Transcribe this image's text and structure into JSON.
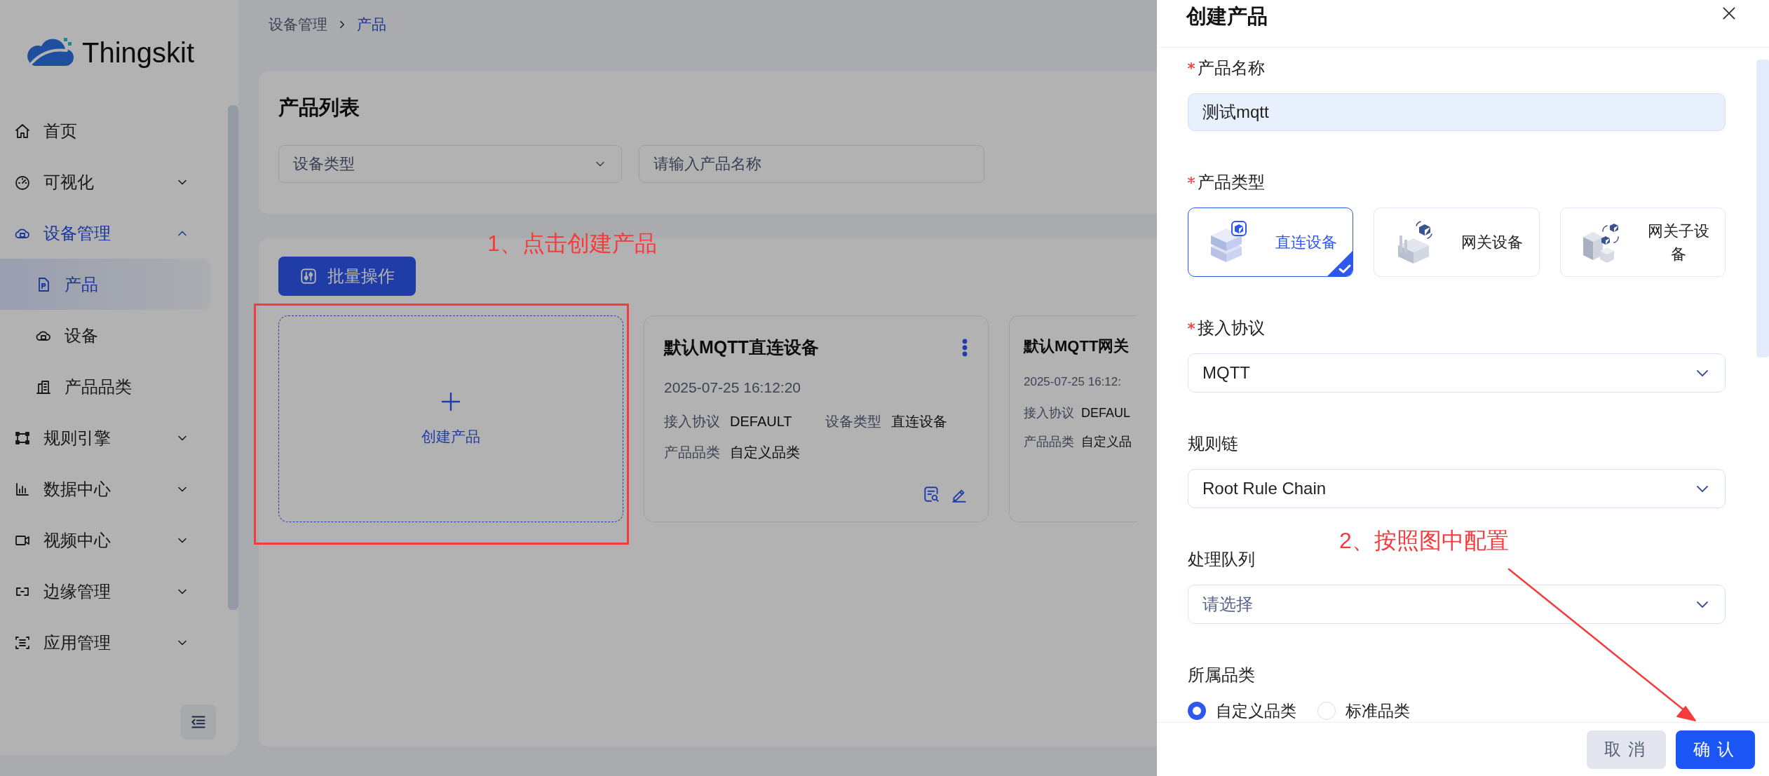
{
  "sidebar": {
    "logo": "Thingskit",
    "items": [
      {
        "kind": "link",
        "label": "首页",
        "selected": false
      },
      {
        "kind": "group",
        "label": "可视化",
        "selected": false,
        "expanded": false
      },
      {
        "kind": "group",
        "label": "设备管理",
        "selected": false,
        "expanded": true,
        "children": [
          {
            "label": "产品",
            "selected": true
          },
          {
            "label": "设备",
            "selected": false
          },
          {
            "label": "产品品类",
            "selected": false
          }
        ]
      },
      {
        "kind": "group",
        "label": "规则引擎",
        "selected": false,
        "expanded": false
      },
      {
        "kind": "group",
        "label": "数据中心",
        "selected": false,
        "expanded": false
      },
      {
        "kind": "group",
        "label": "视频中心",
        "selected": false,
        "expanded": false
      },
      {
        "kind": "group",
        "label": "边缘管理",
        "selected": false,
        "expanded": false
      },
      {
        "kind": "group",
        "label": "应用管理",
        "selected": false,
        "expanded": false
      }
    ]
  },
  "breadcrumb": [
    "设备管理",
    "产品"
  ],
  "filter_panel": {
    "title": "产品列表",
    "device_type_select": {
      "placeholder": "设备类型"
    },
    "name_field": {
      "placeholder": "请输入产品名称"
    }
  },
  "batch_button": "批量操作",
  "create_card": {
    "label": "创建产品"
  },
  "products": [
    {
      "name": "默认MQTT直连设备",
      "time": "2025-07-25 16:12:20",
      "clipped": false,
      "fields": [
        {
          "label": "接入协议",
          "value": "DEFAULT"
        },
        {
          "label": "设备类型",
          "value": "直连设备"
        },
        {
          "label": "产品品类",
          "value": "自定义品类"
        }
      ]
    },
    {
      "name": "默认MQTT网关",
      "time": "2025-07-25 16:12:",
      "clipped": true,
      "fields": [
        {
          "label": "接入协议",
          "value": "DEFAUL"
        },
        {
          "label": "产品品类",
          "value": "自定义品"
        }
      ]
    }
  ],
  "drawer": {
    "title": "创建产品",
    "fields": [
      {
        "kind": "text",
        "label": "产品名称",
        "required": true,
        "value": "测试mqtt"
      },
      {
        "kind": "cards",
        "label": "产品类型",
        "required": true,
        "options": [
          {
            "label": "直连设备",
            "selected": true
          },
          {
            "label": "网关设备",
            "selected": false
          },
          {
            "label": "网关子设备",
            "selected": false
          }
        ]
      },
      {
        "kind": "select",
        "label": "接入协议",
        "required": true,
        "value": "MQTT"
      },
      {
        "kind": "select",
        "label": "规则链",
        "required": false,
        "value": "Root Rule Chain"
      },
      {
        "kind": "select",
        "label": "处理队列",
        "required": false,
        "placeholder": "请选择"
      },
      {
        "kind": "radio",
        "label": "所属品类",
        "required": false,
        "options": [
          {
            "label": "自定义品类",
            "selected": true
          },
          {
            "label": "标准品类",
            "selected": false
          }
        ]
      }
    ],
    "buttons": [
      {
        "kind": "secondary",
        "label": "取消"
      },
      {
        "kind": "primary",
        "label": "确认"
      }
    ]
  },
  "annotations": [
    {
      "text": "1、点击创建产品"
    },
    {
      "text": "2、按照图中配置"
    }
  ]
}
